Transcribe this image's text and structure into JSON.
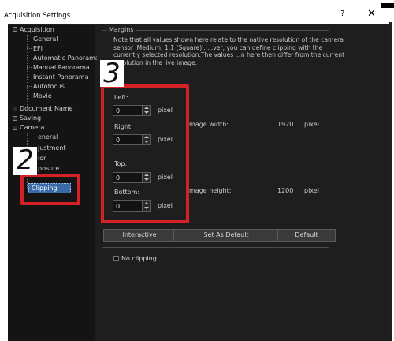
{
  "window": {
    "title": "Acquisition Settings",
    "help_label": "?",
    "close_label": "✕"
  },
  "tree": {
    "acquisition": "Acquisition",
    "acq_children": [
      "General",
      "EFI",
      "Automatic Panorama",
      "Manual Panorama",
      "Instant Panorama",
      "Autofocus",
      "Movie"
    ],
    "document_name": "Document Name",
    "saving": "Saving",
    "camera": "Camera",
    "camera_children_partial": [
      "eneral",
      "justment",
      "lor",
      "posure"
    ],
    "clipping": "Clipping"
  },
  "margins": {
    "group_label": "Margins",
    "note": "Note that all values shown here relate to the native resolution of the camera sensor 'Medium, 1:1 (Square)'. ...ver, you can define clipping with the currently selected resolution.The values ...n here then differ from the current resolution in the live image.",
    "left_label": "Left:",
    "left_value": "0",
    "right_label": "Right:",
    "right_value": "0",
    "top_label": "Top:",
    "top_value": "0",
    "bottom_label": "Bottom:",
    "bottom_value": "0",
    "unit": "pixel",
    "image_width_label": "mage width:",
    "image_width_value": "1920",
    "image_height_label": "mage height:",
    "image_height_value": "1200",
    "width_unit": "pixel",
    "height_unit": "pixel"
  },
  "buttons": {
    "interactive": "Interactive",
    "set_default": "Set As Default",
    "default": "Default"
  },
  "no_clipping_label": "No clipping",
  "callouts": {
    "two": "2",
    "three": "3"
  },
  "colors": {
    "callout_red": "#d42027",
    "selection_blue": "#3a6aa8"
  }
}
